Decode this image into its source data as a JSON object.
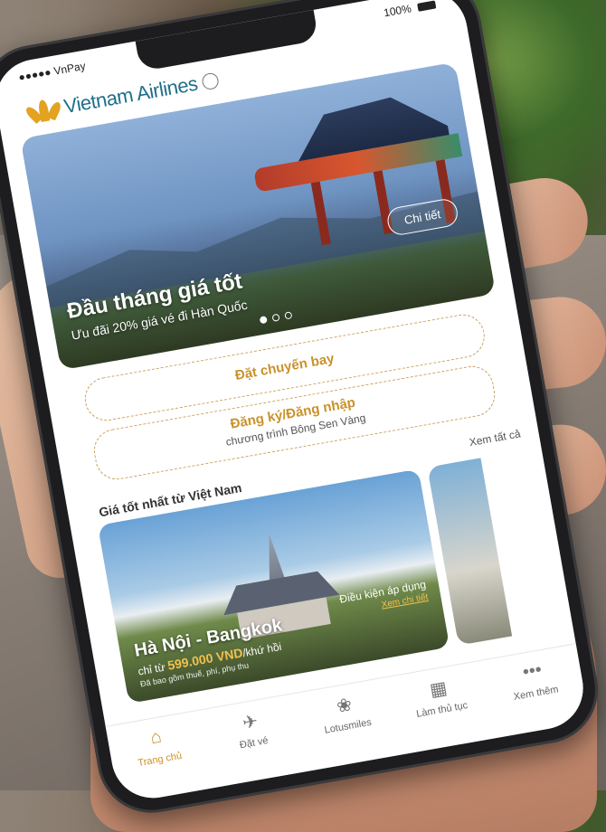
{
  "status_bar": {
    "carrier": "●●●●● VnPay",
    "battery": "100%"
  },
  "header": {
    "brand": "Vietnam Airlines"
  },
  "hero": {
    "title": "Đầu tháng giá tốt",
    "subtitle": "Ưu đãi 20% giá vé đi Hàn Quốc",
    "button": "Chi tiết",
    "slide_count": 3,
    "active_slide": 1
  },
  "actions": {
    "book": "Đặt chuyến bay",
    "login_title": "Đăng ký/Đăng nhập",
    "login_sub": "chương trình Bông Sen Vàng"
  },
  "deals": {
    "title": "Giá tốt nhất từ Việt Nam",
    "see_all": "Xem tất cả",
    "card": {
      "route": "Hà Nội - Bangkok",
      "price_prefix": "chỉ từ",
      "price": "599.000 VND",
      "price_suffix": "/khứ hồi",
      "note": "Đã bao gồm thuế, phí, phụ thu",
      "condition_label": "Điều kiện áp dụng",
      "condition_link": "Xem chi tiết"
    }
  },
  "tabbar": {
    "items": [
      {
        "label": "Trang chủ",
        "icon": "home-icon",
        "glyph": "⌂"
      },
      {
        "label": "Đặt vé",
        "icon": "plane-icon",
        "glyph": "✈"
      },
      {
        "label": "Lotusmiles",
        "icon": "lotus-icon",
        "glyph": "❀"
      },
      {
        "label": "Làm thủ tục",
        "icon": "checkin-icon",
        "glyph": "▦"
      },
      {
        "label": "Xem thêm",
        "icon": "more-icon",
        "glyph": "•••"
      }
    ],
    "active": 0
  },
  "colors": {
    "accent": "#c9922a",
    "brand": "#1e6f8a"
  }
}
